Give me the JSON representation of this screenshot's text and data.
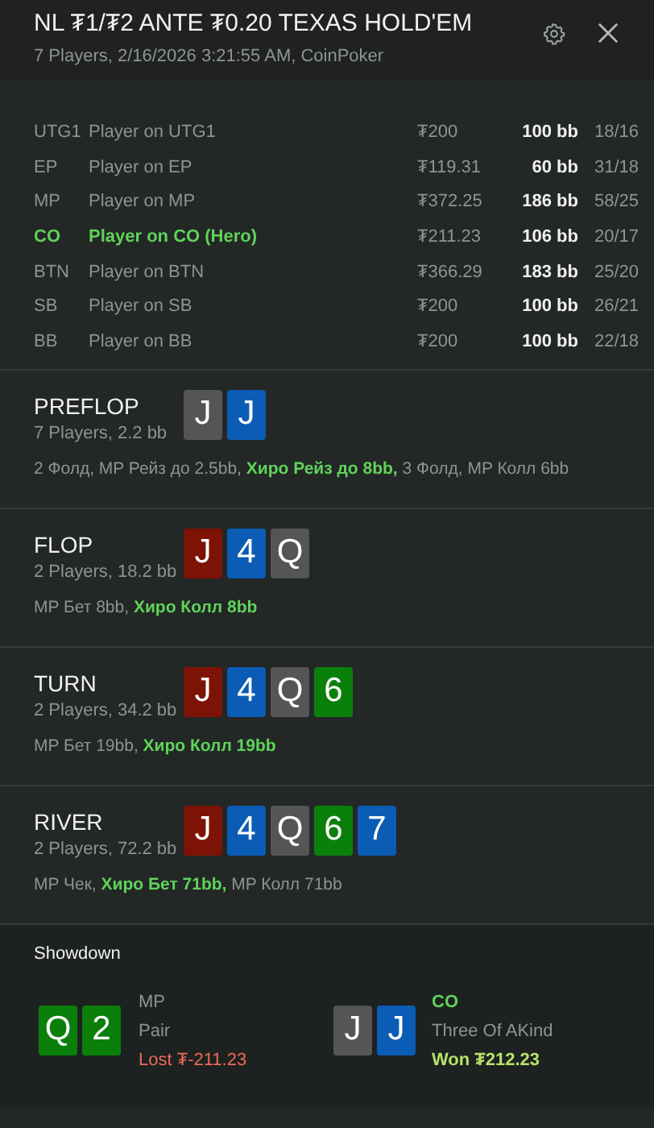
{
  "header": {
    "title": "NL ₮1/₮2 ANTE ₮0.20 TEXAS HOLD'EM",
    "subtitle": "7 Players, 2/16/2026 3:21:55 AM, CoinPoker"
  },
  "players": [
    {
      "position": "UTG1",
      "name": "Player on UTG1",
      "stack": "₮200",
      "bb": "100 bb",
      "stats": "18/16",
      "hero": false
    },
    {
      "position": "EP",
      "name": "Player on EP",
      "stack": "₮119.31",
      "bb": "60 bb",
      "stats": "31/18",
      "hero": false
    },
    {
      "position": "MP",
      "name": "Player on MP",
      "stack": "₮372.25",
      "bb": "186 bb",
      "stats": "58/25",
      "hero": false
    },
    {
      "position": "CO",
      "name": "Player on CO (Hero)",
      "stack": "₮211.23",
      "bb": "106 bb",
      "stats": "20/17",
      "hero": true
    },
    {
      "position": "BTN",
      "name": "Player on BTN",
      "stack": "₮366.29",
      "bb": "183 bb",
      "stats": "25/20",
      "hero": false
    },
    {
      "position": "SB",
      "name": "Player on SB",
      "stack": "₮200",
      "bb": "100 bb",
      "stats": "26/21",
      "hero": false
    },
    {
      "position": "BB",
      "name": "Player on BB",
      "stack": "₮200",
      "bb": "100 bb",
      "stats": "22/18",
      "hero": false
    }
  ],
  "streets": [
    {
      "name": "PREFLOP",
      "info": "7 Players, 2.2 bb",
      "cards": [
        {
          "rank": "J",
          "color": "#555555"
        },
        {
          "rank": "J",
          "color": "#0b5cb5"
        }
      ],
      "actions": [
        {
          "text": "2 Фолд, MP Рейз до 2.5bb, ",
          "hero": false
        },
        {
          "text": "Хиро Рейз до 8bb,",
          "hero": true
        },
        {
          "text": " 3 Фолд, MP Колл 6bb",
          "hero": false
        }
      ]
    },
    {
      "name": "FLOP",
      "info": "2 Players, 18.2 bb",
      "cards": [
        {
          "rank": "J",
          "color": "#7d1206"
        },
        {
          "rank": "4",
          "color": "#0b5cb5"
        },
        {
          "rank": "Q",
          "color": "#555555"
        }
      ],
      "actions": [
        {
          "text": "MP Бет 8bb, ",
          "hero": false
        },
        {
          "text": "Хиро Колл 8bb",
          "hero": true
        }
      ]
    },
    {
      "name": "TURN",
      "info": "2 Players, 34.2 bb",
      "cards": [
        {
          "rank": "J",
          "color": "#7d1206"
        },
        {
          "rank": "4",
          "color": "#0b5cb5"
        },
        {
          "rank": "Q",
          "color": "#555555"
        },
        {
          "rank": "6",
          "color": "#0a800a"
        }
      ],
      "actions": [
        {
          "text": "MP Бет 19bb, ",
          "hero": false
        },
        {
          "text": "Хиро Колл 19bb",
          "hero": true
        }
      ]
    },
    {
      "name": "RIVER",
      "info": "2 Players, 72.2 bb",
      "cards": [
        {
          "rank": "J",
          "color": "#7d1206"
        },
        {
          "rank": "4",
          "color": "#0b5cb5"
        },
        {
          "rank": "Q",
          "color": "#555555"
        },
        {
          "rank": "6",
          "color": "#0a800a"
        },
        {
          "rank": "7",
          "color": "#0b5cb5"
        }
      ],
      "actions": [
        {
          "text": "MP Чек, ",
          "hero": false
        },
        {
          "text": "Хиро Бет 71bb,",
          "hero": true
        },
        {
          "text": " MP Колл 71bb",
          "hero": false
        }
      ]
    }
  ],
  "showdown": {
    "title": "Showdown",
    "hands": [
      {
        "cards": [
          {
            "rank": "Q",
            "color": "#0a800a"
          },
          {
            "rank": "2",
            "color": "#0a800a"
          }
        ],
        "position": "MP",
        "hero": false,
        "hand": "Pair",
        "result": "Lost ₮-211.23",
        "won": false
      },
      {
        "cards": [
          {
            "rank": "J",
            "color": "#555555"
          },
          {
            "rank": "J",
            "color": "#0b5cb5"
          }
        ],
        "position": "CO",
        "hero": true,
        "hand": "Three Of AKind",
        "result": "Won ₮212.23",
        "won": true
      }
    ]
  }
}
